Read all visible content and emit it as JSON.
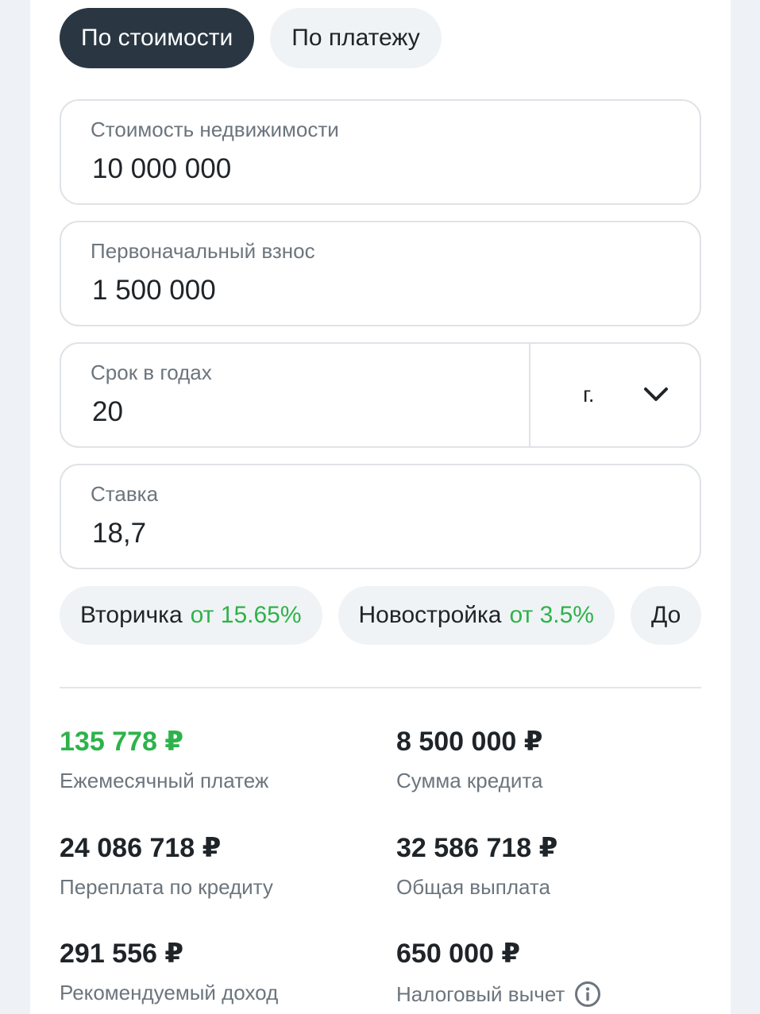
{
  "mode_tabs": {
    "by_cost": "По стоимости",
    "by_payment": "По платежу"
  },
  "fields": {
    "property_cost": {
      "label": "Стоимость недвижимости",
      "value": "10 000 000"
    },
    "down_payment": {
      "label": "Первоначальный взнос",
      "value": "1 500 000"
    },
    "term": {
      "label": "Срок в годах",
      "value": "20",
      "unit": "г."
    },
    "rate": {
      "label": "Ставка",
      "value": "18,7"
    }
  },
  "chips": [
    {
      "label": "Вторичка",
      "rate": "от 15.65%"
    },
    {
      "label": "Новостройка",
      "rate": "от 3.5%"
    },
    {
      "label": "До",
      "rate": ""
    }
  ],
  "results": {
    "monthly_payment": {
      "value": "135 778 ₽",
      "label": "Ежемесячный платеж"
    },
    "loan_amount": {
      "value": "8 500 000 ₽",
      "label": "Сумма кредита"
    },
    "overpayment": {
      "value": "24 086 718 ₽",
      "label": "Переплата по кредиту"
    },
    "total_payment": {
      "value": "32 586 718 ₽",
      "label": "Общая выплата"
    },
    "recommended_income": {
      "value": "291 556 ₽",
      "label": "Рекомендуемый доход"
    },
    "tax_deduction": {
      "value": "650 000 ₽",
      "label": "Налоговый вычет"
    }
  },
  "colors": {
    "accent_green": "#2db34a",
    "active_tab": "#2a3743"
  },
  "icons": {
    "dropdown": "chevron-down-icon",
    "info": "info-icon"
  }
}
